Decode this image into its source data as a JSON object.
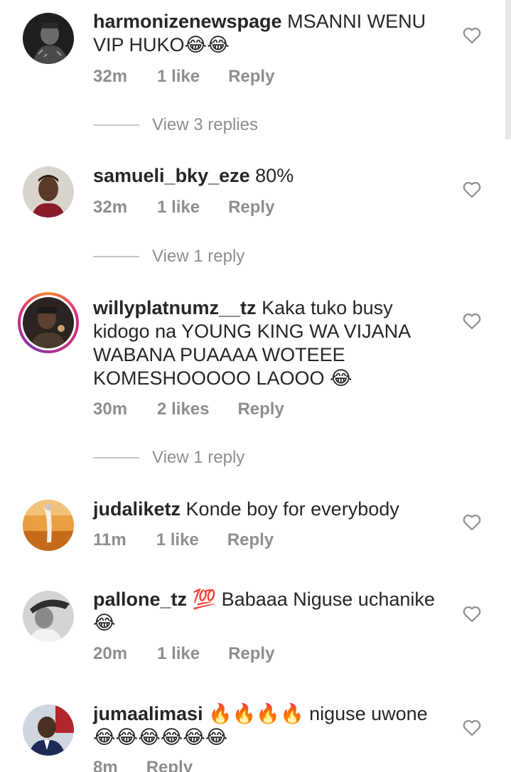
{
  "comments": [
    {
      "username": "harmonizenewspage",
      "text": "MSANNI WENU VIP HUKO😂😂",
      "time": "32m",
      "likes": "1 like",
      "reply": "Reply",
      "view_replies": "View 3 replies"
    },
    {
      "username": "samueli_bky_eze",
      "text": "80%",
      "time": "32m",
      "likes": "1 like",
      "reply": "Reply",
      "view_replies": "View 1 reply"
    },
    {
      "username": "willyplatnumz__tz",
      "text": "Kaka tuko busy kidogo na YOUNG KING WA VIJANA WABANA PUAAAA WOTEEE KOMESHOOOOO LAOOO 😂",
      "time": "30m",
      "likes": "2 likes",
      "reply": "Reply",
      "view_replies": "View 1 reply"
    },
    {
      "username": "judaliketz",
      "text": "Konde boy for everybody",
      "time": "11m",
      "likes": "1 like",
      "reply": "Reply"
    },
    {
      "username": "pallone_tz",
      "text": "💯 Babaaa Niguse uchanike 😂",
      "time": "20m",
      "likes": "1 like",
      "reply": "Reply"
    },
    {
      "username": "jumaalimasi",
      "text": "🔥🔥🔥🔥 niguse uwone 😂😂😂😂😂😂",
      "time": "8m",
      "reply": "Reply"
    }
  ],
  "icons": {
    "heart": "heart-outline-icon"
  },
  "colors": {
    "text": "#262626",
    "meta": "#8e8e8e",
    "story_ring": "#dd2a7b"
  }
}
